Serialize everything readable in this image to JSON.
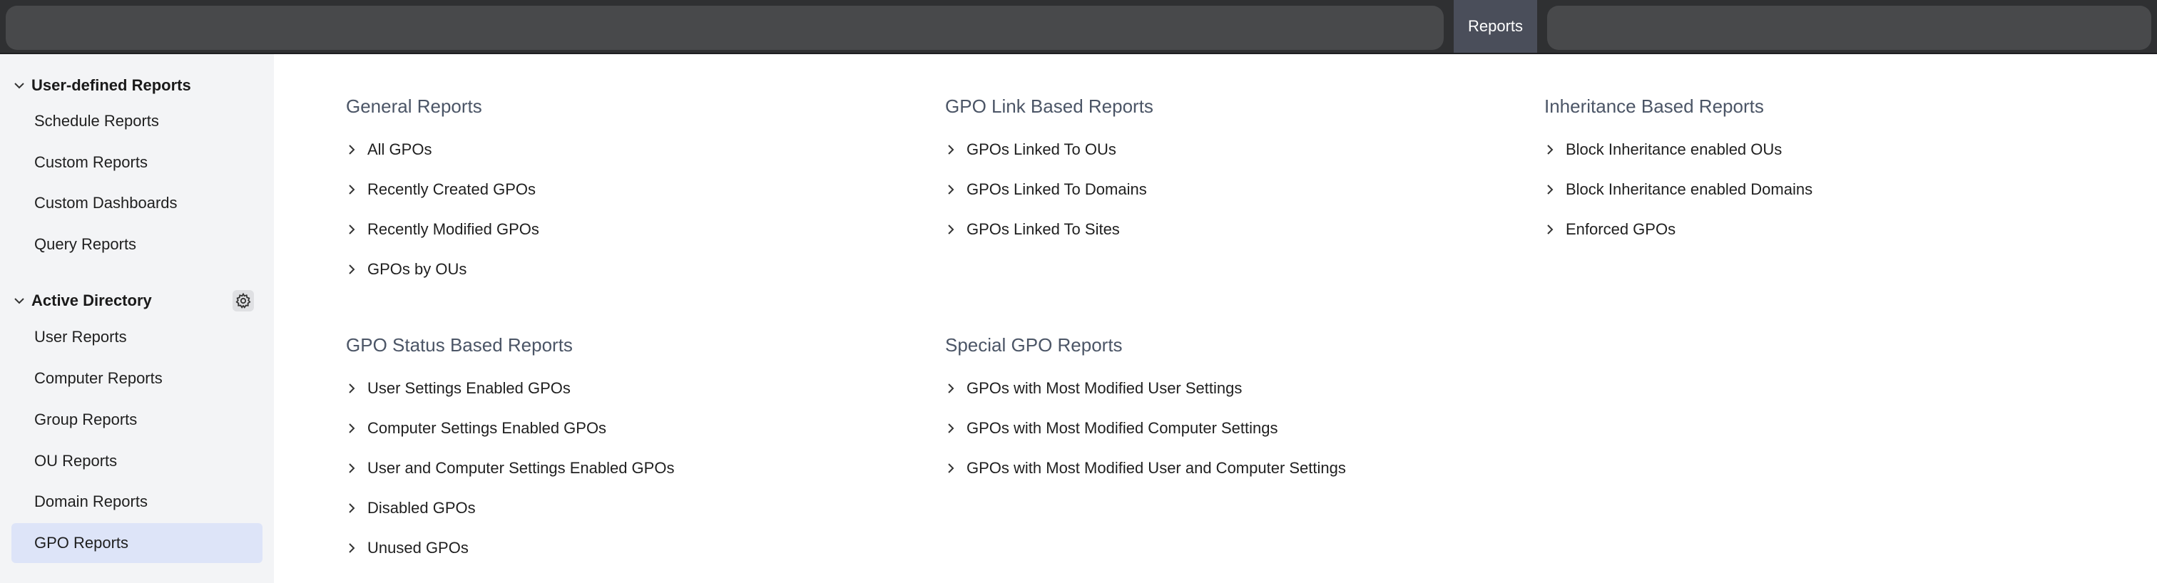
{
  "topbar": {
    "active_tab": "Reports"
  },
  "sidebar": {
    "sections": [
      {
        "title": "User-defined Reports",
        "items": [
          "Schedule Reports",
          "Custom Reports",
          "Custom Dashboards",
          "Query Reports"
        ]
      },
      {
        "title": "Active Directory",
        "items": [
          "User Reports",
          "Computer Reports",
          "Group Reports",
          "OU Reports",
          "Domain Reports",
          "GPO Reports"
        ]
      }
    ],
    "active_item": "GPO Reports"
  },
  "main": {
    "groups": [
      {
        "title": "General Reports",
        "links": [
          "All GPOs",
          "Recently Created GPOs",
          "Recently Modified GPOs",
          "GPOs by OUs"
        ]
      },
      {
        "title": "GPO Link Based Reports",
        "links": [
          "GPOs Linked To OUs",
          "GPOs Linked To Domains",
          "GPOs Linked To Sites"
        ]
      },
      {
        "title": "Inheritance Based Reports",
        "links": [
          "Block Inheritance enabled OUs",
          "Block Inheritance enabled Domains",
          "Enforced GPOs"
        ]
      },
      {
        "title": "GPO Status Based Reports",
        "links": [
          "User Settings Enabled GPOs",
          "Computer Settings Enabled GPOs",
          "User and Computer Settings Enabled GPOs",
          "Disabled GPOs",
          "Unused GPOs"
        ]
      },
      {
        "title": "Special GPO Reports",
        "links": [
          "GPOs with Most Modified User Settings",
          "GPOs with Most Modified Computer Settings",
          "GPOs with Most Modified User and Computer Settings"
        ]
      }
    ]
  }
}
